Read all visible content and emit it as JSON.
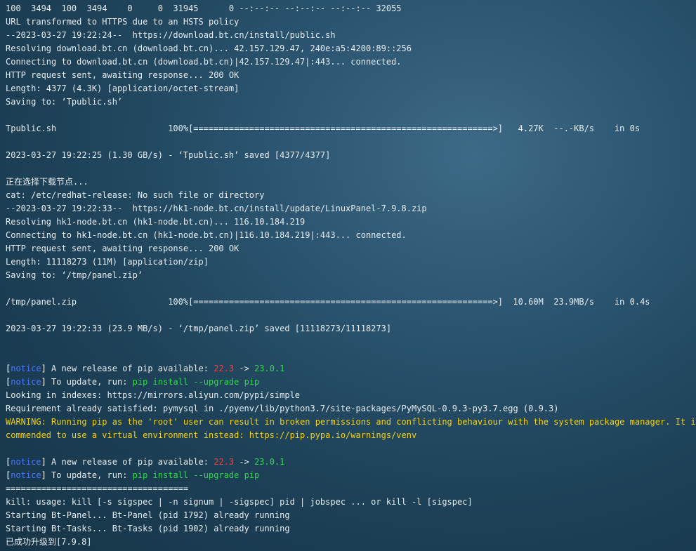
{
  "terminal": {
    "colors": {
      "notice": "#4a78ff",
      "version_old": "#ff3b3b",
      "version_new": "#2fd84a",
      "command": "#2fd84a",
      "warning": "#f5d20a"
    },
    "l00": "100  3494  100  3494    0     0  31945      0 --:--:-- --:--:-- --:--:-- 32055",
    "l01": "URL transformed to HTTPS due to an HSTS policy",
    "l02": "--2023-03-27 19:22:24--  https://download.bt.cn/install/public.sh",
    "l03": "Resolving download.bt.cn (download.bt.cn)... 42.157.129.47, 240e:a5:4200:89::256",
    "l04": "Connecting to download.bt.cn (download.bt.cn)|42.157.129.47|:443... connected.",
    "l05": "HTTP request sent, awaiting response... 200 OK",
    "l06": "Length: 4377 (4.3K) [application/octet-stream]",
    "l07": "Saving to: ‘Tpublic.sh’",
    "l08": "",
    "l09": "Tpublic.sh                      100%[===========================================================>]   4.27K  --.-KB/s    in 0s",
    "l10": "",
    "l11": "2023-03-27 19:22:25 (1.30 GB/s) - ‘Tpublic.sh’ saved [4377/4377]",
    "l12": "",
    "l13": "正在选择下载节点...",
    "l14": "cat: /etc/redhat-release: No such file or directory",
    "l15": "--2023-03-27 19:22:33--  https://hk1-node.bt.cn/install/update/LinuxPanel-7.9.8.zip",
    "l16": "Resolving hk1-node.bt.cn (hk1-node.bt.cn)... 116.10.184.219",
    "l17": "Connecting to hk1-node.bt.cn (hk1-node.bt.cn)|116.10.184.219|:443... connected.",
    "l18": "HTTP request sent, awaiting response... 200 OK",
    "l19": "Length: 11118273 (11M) [application/zip]",
    "l20": "Saving to: ‘/tmp/panel.zip’",
    "l21": "",
    "l22": "/tmp/panel.zip                  100%[===========================================================>]  10.60M  23.9MB/s    in 0.4s",
    "l23": "",
    "l24": "2023-03-27 19:22:33 (23.9 MB/s) - ‘/tmp/panel.zip’ saved [11118273/11118273]",
    "l25": "",
    "l26": "",
    "notice": {
      "open": "[",
      "tag": "notice",
      "close": "]",
      "release_text": " A new release of pip available: ",
      "old_version": "22.3",
      "arrow": " -> ",
      "new_version": "23.0.1",
      "update_text": " To update, run: ",
      "command": "pip install --upgrade pip"
    },
    "l29": "Looking in indexes: https://mirrors.aliyun.com/pypi/simple",
    "l30": "Requirement already satisfied: pymysql in ./pyenv/lib/python3.7/site-packages/PyMySQL-0.9.3-py3.7.egg (0.9.3)",
    "l31": "WARNING: Running pip as the 'root' user can result in broken permissions and conflicting behaviour with the system package manager. It is re",
    "l32": "commended to use a virtual environment instead: https://pip.pypa.io/warnings/venv",
    "l33": "",
    "l36": "====================================",
    "l37": "kill: usage: kill [-s sigspec | -n signum | -sigspec] pid | jobspec ... or kill -l [sigspec]",
    "l38": "Starting Bt-Panel... Bt-Panel (pid 1792) already running",
    "l39": "Starting Bt-Tasks... Bt-Tasks (pid 1902) already running",
    "l40": "已成功升级到[7.9.8]"
  }
}
